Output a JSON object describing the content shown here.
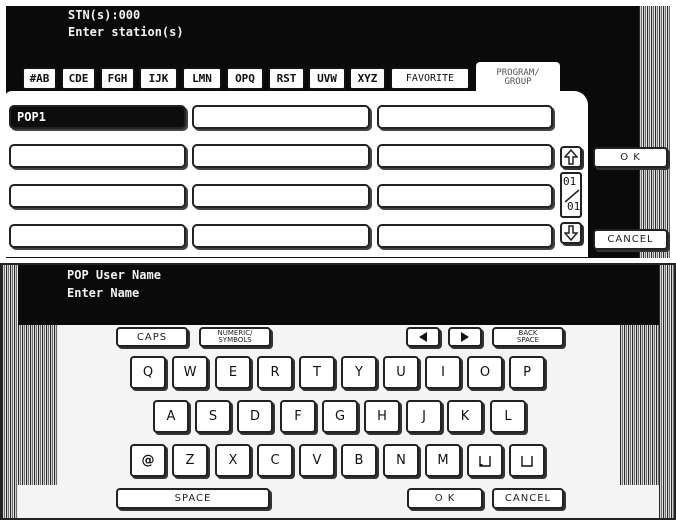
{
  "top": {
    "header_line1": "STN(s):000",
    "header_line2": "Enter station(s)",
    "tabs": [
      "#AB",
      "CDE",
      "FGH",
      "IJK",
      "LMN",
      "OPQ",
      "RST",
      "UVW",
      "XYZ",
      "FAVORITE"
    ],
    "active_tab_line1": "PROGRAM/",
    "active_tab_line2": "GROUP",
    "selected_entry": "POP1",
    "ok_label": "O K",
    "cancel_label": "CANCEL",
    "page_current": "01",
    "page_total": "01",
    "icons": {
      "up": "arrow-up-icon",
      "down": "arrow-down-icon"
    }
  },
  "bottom": {
    "title_line1": "POP User Name",
    "title_line2": "Enter Name",
    "caps_label": "CAPS",
    "numeric_line1": "NUMERIC/",
    "numeric_line2": "SYMBOLS",
    "back_line1": "BACK",
    "back_line2": "SPACE",
    "row1": [
      "Q",
      "W",
      "E",
      "R",
      "T",
      "Y",
      "U",
      "I",
      "O",
      "P"
    ],
    "row2": [
      "A",
      "S",
      "D",
      "F",
      "G",
      "H",
      "J",
      "K",
      "L"
    ],
    "row3": [
      "@",
      "Z",
      "X",
      "C",
      "V",
      "B",
      "N",
      "M",
      "",
      ""
    ],
    "space_label": "SPACE",
    "ok_label": "O K",
    "cancel_label": "CANCEL",
    "icons": {
      "left": "cursor-left-icon",
      "right": "cursor-right-icon",
      "space_key_a": "space-symbol-icon",
      "space_key_b": "space-symbol-icon"
    }
  }
}
